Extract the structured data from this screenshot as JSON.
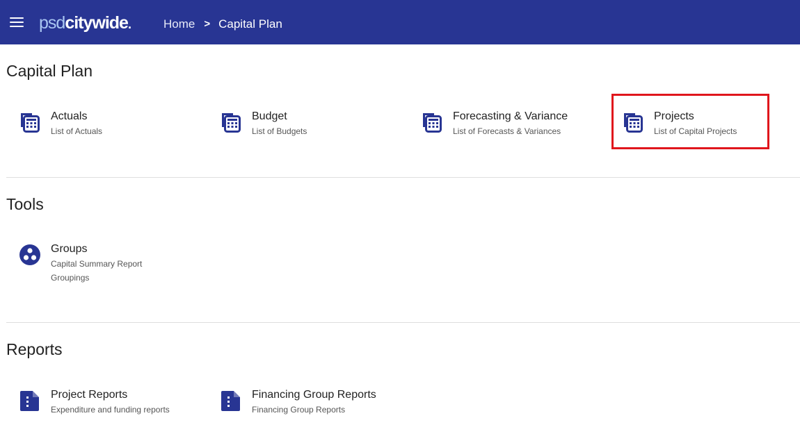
{
  "header": {
    "logo_part1": "psd",
    "logo_part2": "citywide",
    "logo_dot": ".",
    "breadcrumb": {
      "home": "Home",
      "separator": ">",
      "current": "Capital Plan"
    }
  },
  "sections": {
    "capital_plan": {
      "title": "Capital Plan",
      "items": [
        {
          "title": "Actuals",
          "subtitle": "List of Actuals",
          "icon": "calculator-icon"
        },
        {
          "title": "Budget",
          "subtitle": "List of Budgets",
          "icon": "calculator-icon"
        },
        {
          "title": "Forecasting & Variance",
          "subtitle": "List of Forecasts & Variances",
          "icon": "calculator-icon"
        },
        {
          "title": "Projects",
          "subtitle": "List of Capital Projects",
          "icon": "calculator-icon"
        }
      ]
    },
    "tools": {
      "title": "Tools",
      "items": [
        {
          "title": "Groups",
          "subtitle": "Capital Summary Report",
          "subtitle2": "Groupings",
          "icon": "groups-icon"
        }
      ]
    },
    "reports": {
      "title": "Reports",
      "items": [
        {
          "title": "Project Reports",
          "subtitle": "Expenditure and funding reports",
          "icon": "report-document-icon"
        },
        {
          "title": "Financing Group Reports",
          "subtitle": "Financing Group Reports",
          "icon": "report-document-icon"
        }
      ]
    }
  },
  "colors": {
    "header_bg": "#283593",
    "icon": "#283593",
    "highlight_border": "#e0161c"
  }
}
